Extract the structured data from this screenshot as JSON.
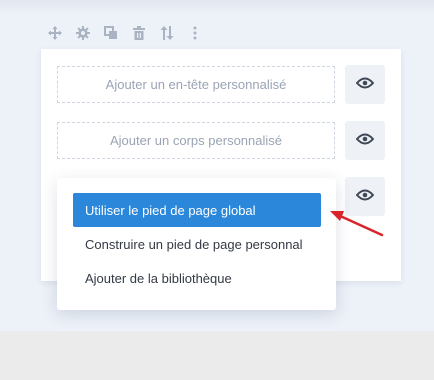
{
  "toolbar": {
    "icons": [
      "move-icon",
      "gear-icon",
      "duplicate-icon",
      "trash-icon",
      "sort-arrows-icon",
      "more-vertical-icon"
    ]
  },
  "template_slots": {
    "header": {
      "label": "Ajouter un en-tête personnalisé"
    },
    "body": {
      "label": "Ajouter un corps personnalisé"
    }
  },
  "visibility_icon": "eye-icon",
  "footer_menu": {
    "items": [
      {
        "label": "Utiliser le pied de page global",
        "active": true
      },
      {
        "label": "Construire un pied de page personnal",
        "active": false
      },
      {
        "label": "Ajouter de la bibliothèque",
        "active": false
      }
    ]
  },
  "colors": {
    "accent": "#2b87da",
    "annotation_arrow": "#d9242a",
    "page_background": "#edf1f8"
  }
}
